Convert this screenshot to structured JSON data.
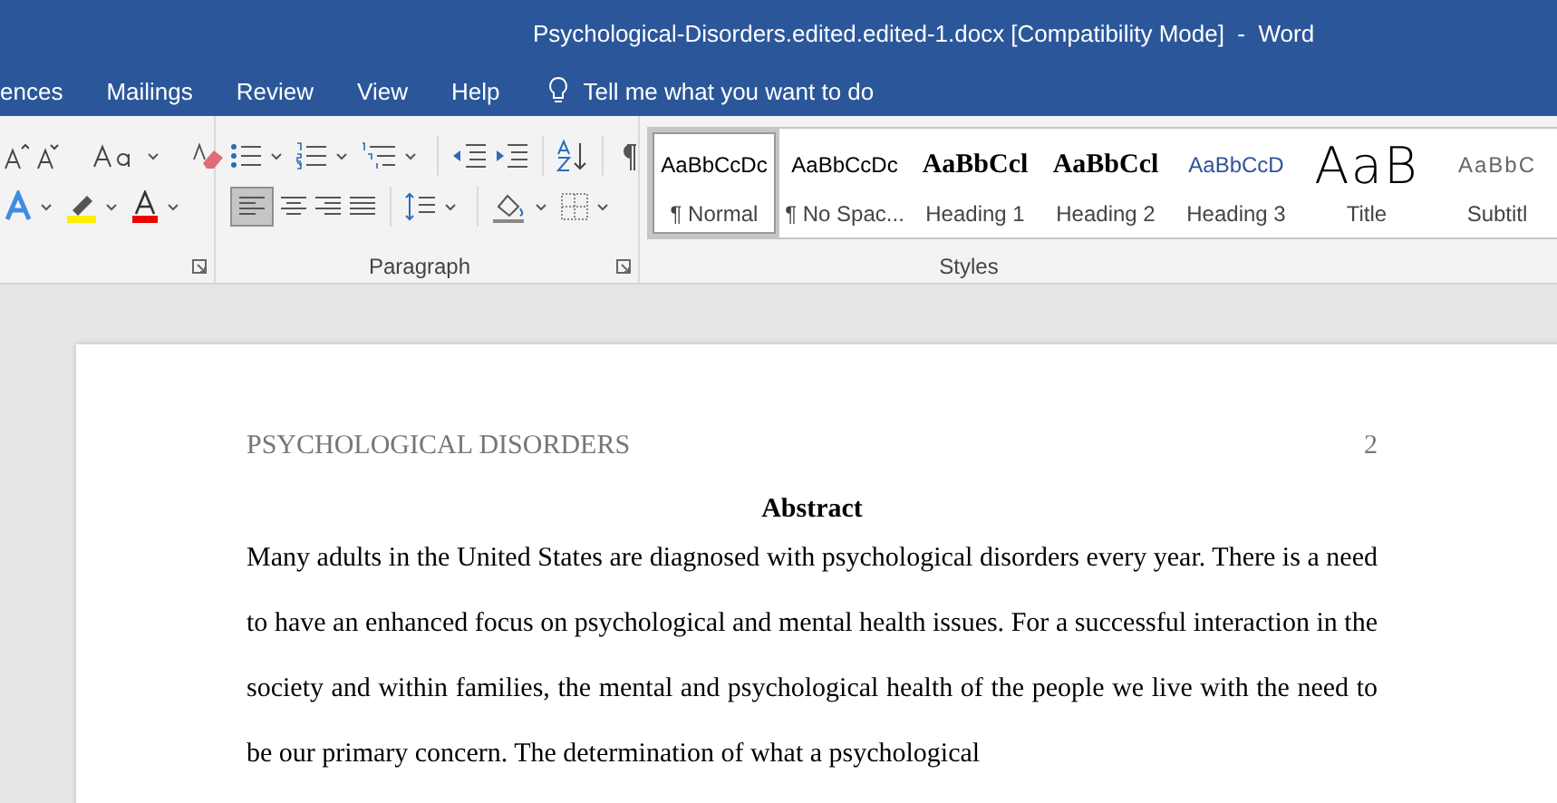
{
  "window": {
    "title": "Psychological-Disorders.edited.edited-1.docx [Compatibility Mode]  -  Word"
  },
  "tabs": [
    {
      "label": "ences",
      "selected": false
    },
    {
      "label": "Mailings",
      "selected": false
    },
    {
      "label": "Review",
      "selected": false
    },
    {
      "label": "View",
      "selected": false
    },
    {
      "label": "Help",
      "selected": false
    }
  ],
  "tell_me": {
    "placeholder": "Tell me what you want to do"
  },
  "ribbon": {
    "paragraph_group": {
      "label": "Paragraph",
      "align_left_selected": true
    },
    "styles_group": {
      "label": "Styles",
      "styles": [
        {
          "kind": "normal",
          "sample": "AaBbCcDc",
          "name": "¶ Normal",
          "selected": true
        },
        {
          "kind": "normal",
          "sample": "AaBbCcDc",
          "name": "¶ No Spac...",
          "selected": false
        },
        {
          "kind": "heading",
          "sample": "AaBbCcl",
          "name": "Heading 1",
          "selected": false
        },
        {
          "kind": "heading",
          "sample": "AaBbCcl",
          "name": "Heading 2",
          "selected": false
        },
        {
          "kind": "heading3",
          "sample": "AaBbCcD",
          "name": "Heading 3",
          "selected": false
        },
        {
          "kind": "title",
          "sample": "AaB",
          "name": "Title",
          "selected": false
        },
        {
          "kind": "subtitle",
          "sample": "AaBbC",
          "name": "Subtitl",
          "selected": false
        }
      ]
    }
  },
  "document": {
    "header": "PSYCHOLOGICAL DISORDERS",
    "page_number": "2",
    "heading": "Abstract",
    "paragraph": "Many adults in the United States are diagnosed with psychological disorders every year. There is a need to have an enhanced focus on psychological and mental health issues. For a successful interaction in the society and within families, the mental and psychological health of the people we live with the need to be our primary concern. The determination of what a psychological"
  }
}
